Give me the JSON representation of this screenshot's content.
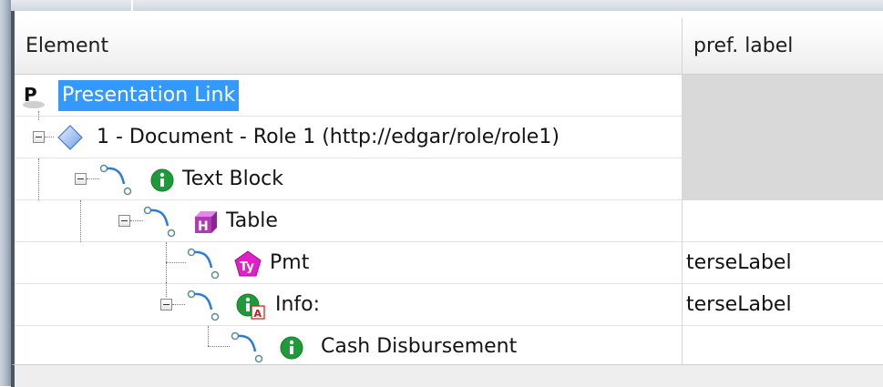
{
  "columns": {
    "element": "Element",
    "pref_label": "pref. label"
  },
  "rows": [
    {
      "label": "Presentation Link",
      "pref": "",
      "icon": "presentation-link-icon",
      "selected": true
    },
    {
      "label": "1 - Document - Role 1 (http://edgar/role/role1)",
      "pref": "",
      "icon": "role-diamond-icon"
    },
    {
      "label": "Text Block",
      "pref": "",
      "icon": "item-i-icon"
    },
    {
      "label": "Table",
      "pref": "",
      "icon": "hypercube-h-icon"
    },
    {
      "label": "Pmt",
      "pref": "terseLabel",
      "icon": "typed-dimension-ty-icon"
    },
    {
      "label": "Info:",
      "pref": "terseLabel",
      "icon": "abstract-item-icon"
    },
    {
      "label": "Cash Disbursement",
      "pref": "",
      "icon": "item-i-icon"
    }
  ],
  "colors": {
    "selection": "#3399ff",
    "item_green": "#1f9a3a",
    "hypercube_purple": "#b03ab8",
    "dimension_magenta": "#e020c8"
  }
}
